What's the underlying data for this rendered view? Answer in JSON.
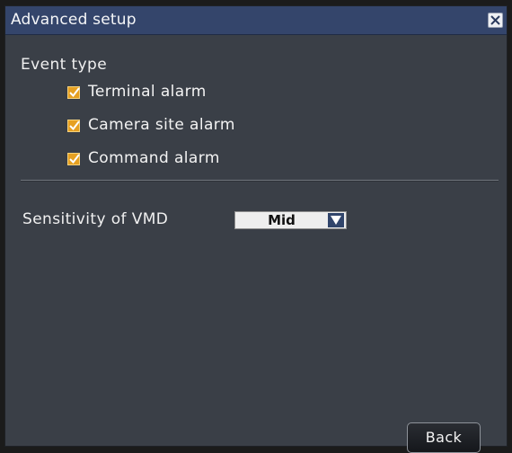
{
  "window": {
    "title": "Advanced setup",
    "close_icon": "close-icon"
  },
  "event_type": {
    "label": "Event type",
    "items": [
      {
        "label": "Terminal alarm",
        "checked": true
      },
      {
        "label": "Camera site alarm",
        "checked": true
      },
      {
        "label": "Command alarm",
        "checked": true
      }
    ]
  },
  "vmd": {
    "label": "Sensitivity of VMD",
    "selected": "Mid",
    "arrow_icon": "triangle-down-icon"
  },
  "buttons": {
    "back": "Back"
  },
  "colors": {
    "panel": "#3a3f47",
    "titlebar": "#34456b",
    "checkbox": "#e6a021"
  }
}
